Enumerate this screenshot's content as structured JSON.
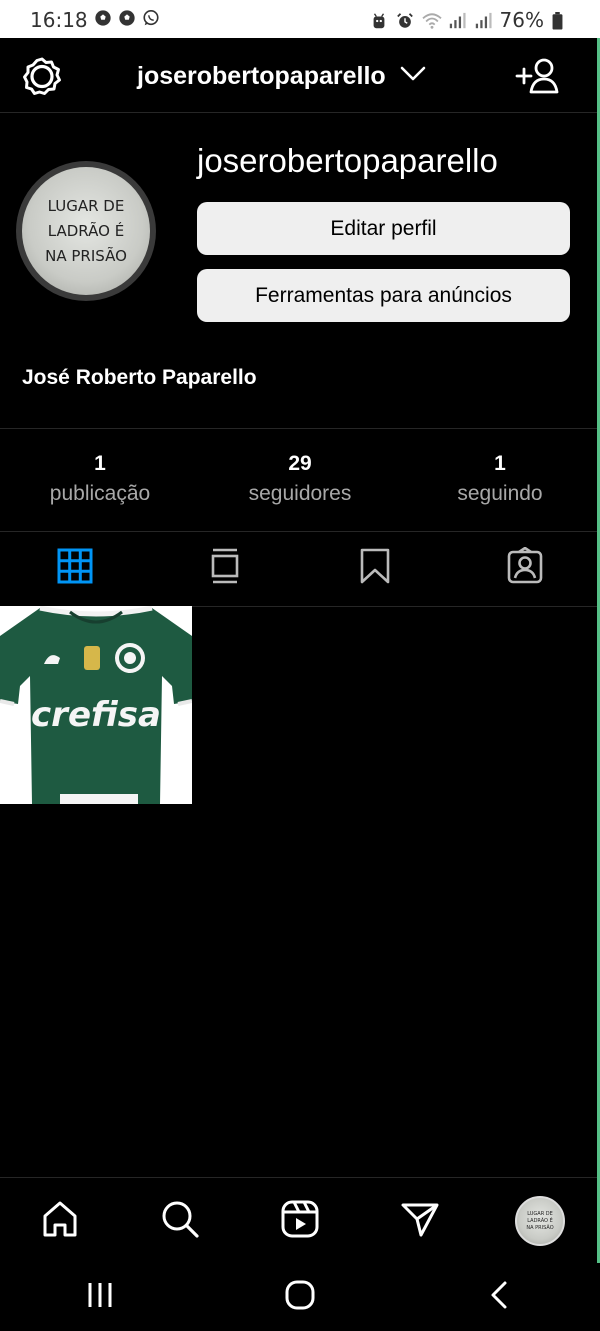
{
  "status_bar": {
    "time": "16:18",
    "battery": "76%",
    "icons": [
      "soccer-ball-icon",
      "soccer-ball-icon",
      "whatsapp-icon",
      "android-icon",
      "alarm-icon",
      "wifi-icon",
      "signal-icon",
      "signal-icon",
      "battery-icon"
    ]
  },
  "header": {
    "username": "joserobertopaparello",
    "icons": [
      "settings-icon",
      "chevron-down-icon",
      "add-user-icon"
    ]
  },
  "profile": {
    "handle": "joserobertopaparello",
    "avatar_text": [
      "LUGAR DE",
      "LADRÃO É",
      "NA PRISÃO"
    ],
    "edit_button": "Editar perfil",
    "ads_button": "Ferramentas para anúncios",
    "full_name": "José Roberto Paparello"
  },
  "stats": [
    {
      "value": "1",
      "label": "publicação"
    },
    {
      "value": "29",
      "label": "seguidores"
    },
    {
      "value": "1",
      "label": "seguindo"
    }
  ],
  "tabs": {
    "items": [
      "grid-icon",
      "guide-icon",
      "saved-icon",
      "tagged-icon"
    ],
    "active_index": 0,
    "active_color": "#0095f6"
  },
  "posts": [
    {
      "description": "Palmeiras green football jersey",
      "text": "crefisa"
    }
  ],
  "bottom_nav": [
    "home-icon",
    "search-icon",
    "reels-icon",
    "direct-icon",
    "profile-avatar"
  ],
  "colors": {
    "background": "#000000",
    "button_bg": "#efefef",
    "divider": "#262626",
    "jersey": "#1e5a41"
  }
}
